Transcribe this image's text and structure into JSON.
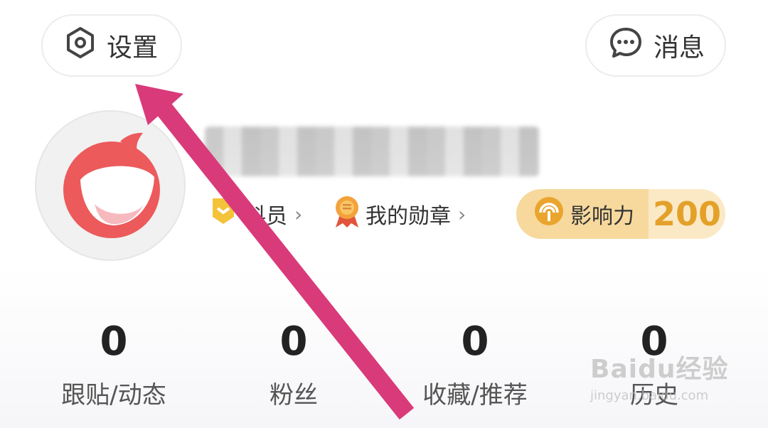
{
  "header": {
    "settings_label": "设置",
    "messages_label": "消息",
    "settings_icon": "gear-hexagon-icon",
    "messages_icon": "chat-bubble-icon"
  },
  "profile": {
    "level_label": "科员",
    "medal_label": "我的勋章",
    "influence_label": "影响力",
    "influence_value": "200",
    "accent_color": "#e3a12a",
    "avatar_icon": "smiling-mascot-icon"
  },
  "stats": [
    {
      "value": "0",
      "label": "跟贴/动态"
    },
    {
      "value": "0",
      "label": "粉丝"
    },
    {
      "value": "0",
      "label": "收藏/推荐"
    },
    {
      "value": "0",
      "label": "历史"
    }
  ],
  "watermark": {
    "brand": "Baidu经验",
    "url": "jingyan.baidu.com"
  },
  "annotation": {
    "color": "#d93a7a"
  }
}
